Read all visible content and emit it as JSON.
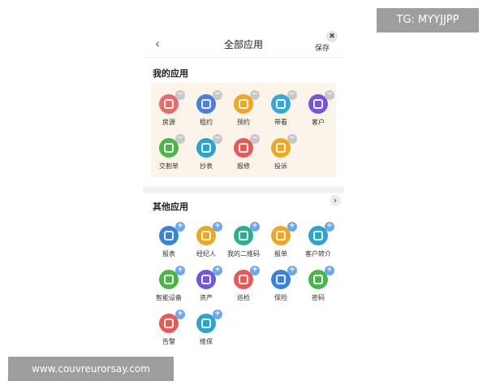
{
  "header": {
    "back_icon": "chevron-left-icon",
    "title": "全部应用",
    "save_label": "保存",
    "close_icon": "close-icon"
  },
  "my_apps": {
    "title": "我的应用",
    "items": [
      {
        "label": "房源",
        "color": "#e96a6a",
        "badge": "−"
      },
      {
        "label": "租约",
        "color": "#4a7fe0",
        "badge": "−"
      },
      {
        "label": "预约",
        "color": "#f0a524",
        "badge": "−"
      },
      {
        "label": "带看",
        "color": "#3aa6d8",
        "badge": "−"
      },
      {
        "label": "客户",
        "color": "#7657d6",
        "badge": "−"
      },
      {
        "label": "交割单",
        "color": "#4db34a",
        "badge": "−"
      },
      {
        "label": "抄表",
        "color": "#2ea5c8",
        "badge": "−"
      },
      {
        "label": "报修",
        "color": "#e85a5a",
        "badge": "−"
      },
      {
        "label": "投诉",
        "color": "#f0a524",
        "badge": "−"
      }
    ]
  },
  "other_apps": {
    "title": "其他应用",
    "more_label": "›",
    "items": [
      {
        "label": "报表",
        "color": "#3a82d8",
        "badge": "+"
      },
      {
        "label": "经纪人",
        "color": "#f0a524",
        "badge": "+"
      },
      {
        "label": "我的二维码",
        "color": "#2fae8c",
        "badge": "+"
      },
      {
        "label": "报单",
        "color": "#f0a524",
        "badge": "+"
      },
      {
        "label": "客户转介",
        "color": "#2ea5c8",
        "badge": "+"
      },
      {
        "label": "智能设备",
        "color": "#4db34a",
        "badge": "+"
      },
      {
        "label": "资产",
        "color": "#7657d6",
        "badge": "+"
      },
      {
        "label": "巡检",
        "color": "#e85a5a",
        "badge": "+"
      },
      {
        "label": "保险",
        "color": "#3a82d8",
        "badge": "+"
      },
      {
        "label": "密码",
        "color": "#4db34a",
        "badge": "+"
      },
      {
        "label": "告警",
        "color": "#e85a5a",
        "badge": "+"
      },
      {
        "label": "维保",
        "color": "#2ea5c8",
        "badge": "+"
      }
    ]
  },
  "watermarks": {
    "tg": "TG: MYYJJPP",
    "url": "www.couvreurorsay.com"
  }
}
